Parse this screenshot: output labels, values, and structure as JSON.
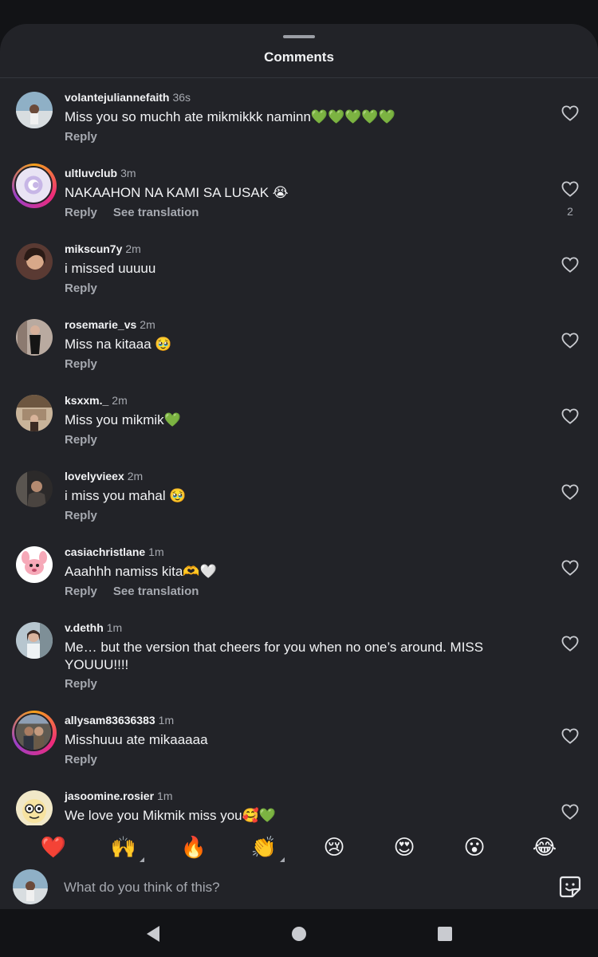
{
  "sheet": {
    "title": "Comments"
  },
  "comments": [
    {
      "username": "volantejulianne­faith",
      "time": "36s",
      "text": "Miss you so muchh ate mikmikkk naminn💚💚💚💚💚",
      "reply": "Reply",
      "see_translation": "",
      "likes": ""
    },
    {
      "username": "ultluvclub",
      "time": "3m",
      "text": "NAKAAHON NA KAMI SA LUSAK 😭",
      "reply": "Reply",
      "see_translation": "See translation",
      "likes": "2"
    },
    {
      "username": "mikscun7y",
      "time": "2m",
      "text": "i missed uuuuu",
      "reply": "Reply",
      "see_translation": "",
      "likes": ""
    },
    {
      "username": "rosemarie_vs",
      "time": "2m",
      "text": "Miss na kitaaa 🥹",
      "reply": "Reply",
      "see_translation": "",
      "likes": ""
    },
    {
      "username": "ksxxm._",
      "time": "2m",
      "text": "Miss you mikmik💚",
      "reply": "Reply",
      "see_translation": "",
      "likes": ""
    },
    {
      "username": "lovelyvieex",
      "time": "2m",
      "text": "i miss you mahal 🥹",
      "reply": "Reply",
      "see_translation": "",
      "likes": ""
    },
    {
      "username": "casiachristlane",
      "time": "1m",
      "text": "Aaahhh namiss kita🫶🤍",
      "reply": "Reply",
      "see_translation": "See translation",
      "likes": ""
    },
    {
      "username": "v.dethh",
      "time": "1m",
      "text": "Me… but the version that cheers for you when no one’s around. MISS YOUUU!!!!",
      "reply": "Reply",
      "see_translation": "",
      "likes": ""
    },
    {
      "username": "allysam83636383",
      "time": "1m",
      "text": "Misshuuu ate mikaaaaa",
      "reply": "Reply",
      "see_translation": "",
      "likes": ""
    },
    {
      "username": "jasoomine.rosier",
      "time": "1m",
      "text": "We love you Mikmik miss you🥰💚",
      "reply": "Reply",
      "see_translation": "",
      "likes": ""
    }
  ],
  "reactions": [
    "❤️",
    "🙌",
    "🔥",
    "👏",
    "😢",
    "😍",
    "😮",
    "😂"
  ],
  "composer": {
    "placeholder": "What do you think of this?"
  },
  "icons": {
    "heart": "heart-outline-icon",
    "sticker": "sticker-icon",
    "nav_back": "triangle-back-icon",
    "nav_home": "circle-home-icon",
    "nav_recents": "square-recents-icon"
  },
  "colors": {
    "sheet_bg": "#222328",
    "text": "#f2f3f5",
    "muted": "#a6a9b0",
    "ring_start": "#f7a21a",
    "ring_end": "#9b3fc7"
  }
}
